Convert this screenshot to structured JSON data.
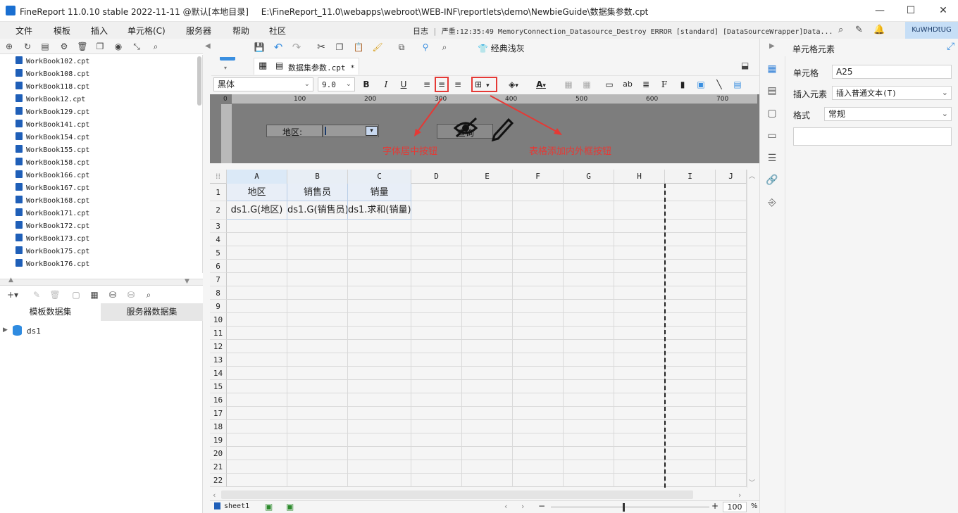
{
  "window": {
    "title": "FineReport 11.0.10 stable 2022-11-11 @默认[本地目录]",
    "path": "E:\\FineReport_11.0\\webapps\\webroot\\WEB-INF\\reportlets\\demo\\NewbieGuide\\数据集参数.cpt",
    "minimize": "—",
    "maximize": "☐",
    "close": "✕"
  },
  "menu": [
    "文件",
    "模板",
    "插入",
    "单元格(C)",
    "服务器",
    "帮助",
    "社区"
  ],
  "log": {
    "label": "日志",
    "message": "严重:12:35:49 MemoryConnection_Datasource_Destroy ERROR [standard] [DataSourceWrapper]Data..."
  },
  "user": "KuWHDtUG",
  "files": [
    "WorkBook102.cpt",
    "WorkBook108.cpt",
    "WorkBook118.cpt",
    "WorkBook12.cpt",
    "WorkBook129.cpt",
    "WorkBook141.cpt",
    "WorkBook154.cpt",
    "WorkBook155.cpt",
    "WorkBook158.cpt",
    "WorkBook166.cpt",
    "WorkBook167.cpt",
    "WorkBook168.cpt",
    "WorkBook171.cpt",
    "WorkBook172.cpt",
    "WorkBook173.cpt",
    "WorkBook175.cpt",
    "WorkBook176.cpt"
  ],
  "datasets": {
    "tabs": [
      "模板数据集",
      "服务器数据集"
    ],
    "items": [
      "ds1"
    ]
  },
  "toolbar": {
    "theme_label": "经典浅灰"
  },
  "doc_tab": {
    "label": "数据集参数.cpt *"
  },
  "format": {
    "font": "黑体",
    "size": "9.0"
  },
  "ruler_ticks": [
    "0",
    "100",
    "200",
    "300",
    "400",
    "500",
    "600",
    "700"
  ],
  "param_pane": {
    "region_label": "地区:",
    "query_label": "查询"
  },
  "annotations": {
    "center_align": "字体居中按钮",
    "border": "表格添加内外框按钮"
  },
  "grid": {
    "columns": [
      "A",
      "B",
      "C",
      "D",
      "E",
      "F",
      "G",
      "H",
      "I",
      "J"
    ],
    "rows": [
      "1",
      "2",
      "3",
      "4",
      "5",
      "6",
      "7",
      "8",
      "9",
      "10",
      "11",
      "12",
      "13",
      "14",
      "15",
      "16",
      "17",
      "18",
      "19",
      "20",
      "21",
      "22"
    ],
    "row1": [
      "地区",
      "销售员",
      "销量"
    ],
    "row2": [
      "ds1.G(地区)",
      "ds1.G(销售员)",
      "ds1.求和(销量)"
    ]
  },
  "sheet": {
    "name": "sheet1",
    "zoom": "100",
    "zoom_unit": "%"
  },
  "right_pane": {
    "title": "单元格元素",
    "cell_label": "单元格",
    "cell_value": "A25",
    "insert_label": "插入元素",
    "insert_value": "插入普通文本(T)",
    "format_label": "格式",
    "format_value": "常规"
  }
}
